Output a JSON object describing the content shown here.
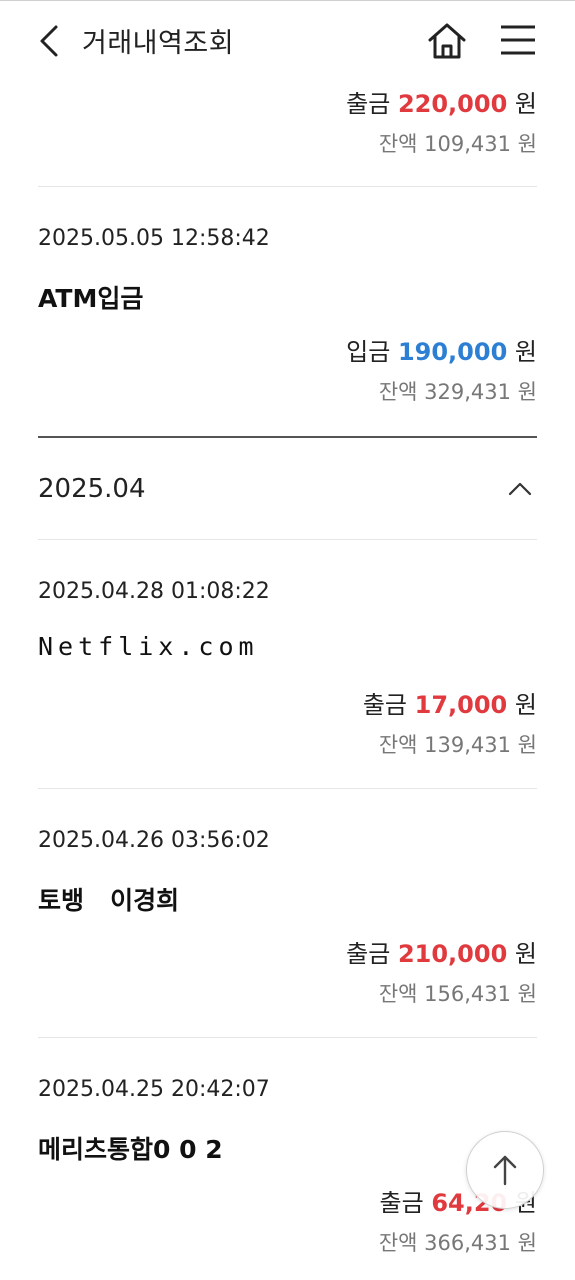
{
  "header": {
    "title": "거래내역조회",
    "back_icon": "chevron-left-icon",
    "home_icon": "home-icon",
    "menu_icon": "hamburger-menu-icon"
  },
  "colors": {
    "withdrawal": "#e0393e",
    "deposit": "#2d7fd3"
  },
  "partial_top": {
    "type_label": "출금",
    "amount": "220,000",
    "currency": "원",
    "balance_label": "잔액",
    "balance": "109,431",
    "balance_currency": "원"
  },
  "tx1": {
    "datetime": "2025.05.05 12:58:42",
    "description": "ATM입금",
    "type_label": "입금",
    "amount": "190,000",
    "currency": "원",
    "balance_label": "잔액",
    "balance": "329,431",
    "balance_currency": "원"
  },
  "month_header": {
    "label": "2025.04",
    "icon": "chevron-up-icon"
  },
  "tx2": {
    "datetime": "2025.04.28 01:08:22",
    "description": "Netflix.com",
    "type_label": "출금",
    "amount": "17,000",
    "currency": "원",
    "balance_label": "잔액",
    "balance": "139,431",
    "balance_currency": "원"
  },
  "tx3": {
    "datetime": "2025.04.26 03:56:02",
    "description": "토뱅   이경희",
    "type_label": "출금",
    "amount": "210,000",
    "currency": "원",
    "balance_label": "잔액",
    "balance": "156,431",
    "balance_currency": "원"
  },
  "tx4": {
    "datetime": "2025.04.25 20:42:07",
    "description": "메리츠통합0 0 2",
    "type_label": "출금",
    "amount": "64,20",
    "currency": "원",
    "balance_label": "잔액",
    "balance": "366,431",
    "balance_currency": "원"
  },
  "fab": {
    "icon": "arrow-up-icon"
  }
}
